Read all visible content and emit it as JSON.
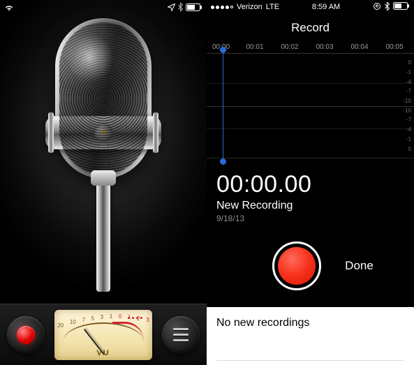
{
  "left": {
    "vu_label": "VU",
    "vu_scale": [
      "20",
      "10",
      "7",
      "5",
      "3",
      "1",
      "0",
      "1",
      "2",
      "3"
    ]
  },
  "right": {
    "status": {
      "carrier": "Verizon",
      "network": "LTE",
      "time": "8:59 AM"
    },
    "title": "Record",
    "timeline": [
      "00:00",
      "00:01",
      "00:02",
      "00:03",
      "00:04",
      "00:05"
    ],
    "db_labels": [
      "0",
      "-1",
      "-4",
      "-7",
      "-10",
      "-10",
      "-7",
      "-4",
      "-1",
      "0"
    ],
    "elapsed": "00:00.00",
    "recording_name": "New Recording",
    "recording_date": "9/18/13",
    "done_label": "Done",
    "empty_list_label": "No new recordings"
  }
}
